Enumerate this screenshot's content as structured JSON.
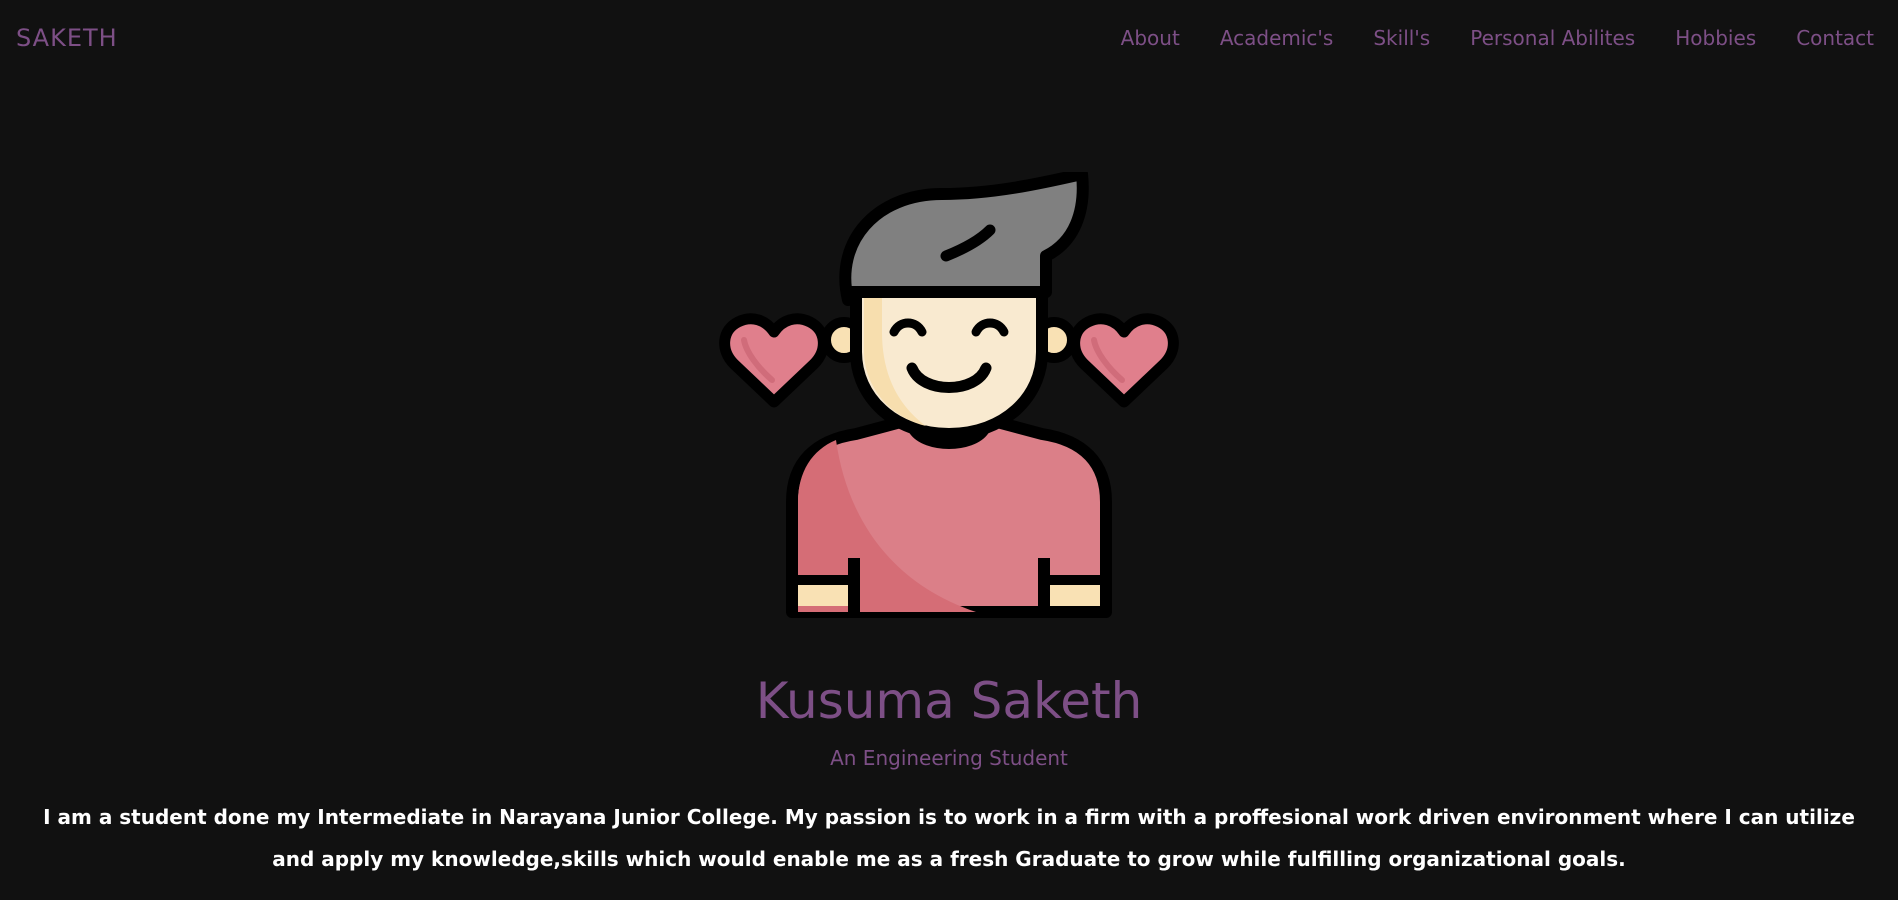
{
  "brand": "SAKETH",
  "nav": {
    "items": [
      {
        "label": "About"
      },
      {
        "label": "Academic's"
      },
      {
        "label": "Skill's"
      },
      {
        "label": "Personal Abilites"
      },
      {
        "label": "Hobbies"
      },
      {
        "label": "Contact"
      }
    ]
  },
  "hero": {
    "avatar_icon": "boy-with-hearts-icon",
    "name": "Kusuma Saketh",
    "subtitle": "An Engineering Student",
    "bio": "I am a student done my Intermediate in Narayana Junior College. My passion is to work in a firm with a proffesional work driven environment where I can utilize and apply my knowledge,skills which would enable me as a fresh Graduate to grow while fulfilling organizational goals."
  },
  "colors": {
    "background": "#111111",
    "accent": "#7d4f86",
    "text": "#ffffff",
    "heart": "#e07f8c",
    "shirt": "#db7f88",
    "hair": "#808080",
    "skin": "#f9ead0"
  }
}
